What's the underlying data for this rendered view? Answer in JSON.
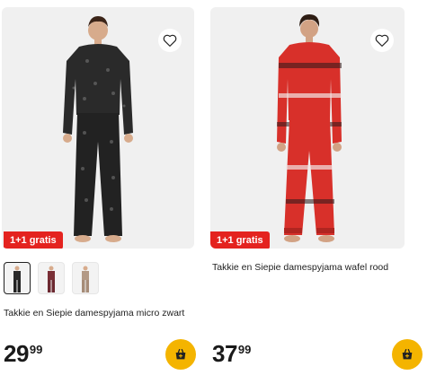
{
  "products": [
    {
      "badge": "1+1 gratis",
      "title": "Takkie en Siepie damespyjama micro zwart",
      "price_int": "29",
      "price_dec": "99",
      "swatches": [
        "zwart",
        "rood",
        "beige"
      ],
      "selected_swatch": 0,
      "color": "#2b2b2b"
    },
    {
      "badge": "1+1 gratis",
      "title": "Takkie en Siepie damespyjama wafel rood",
      "price_int": "37",
      "price_dec": "99",
      "color": "#d8302a"
    }
  ],
  "icons": {
    "favorite": "heart-icon",
    "cart": "shopping-basket-icon"
  },
  "colors": {
    "badge": "#e4231f",
    "cart_button": "#f4b400",
    "photo_bg": "#f0f0f0"
  }
}
